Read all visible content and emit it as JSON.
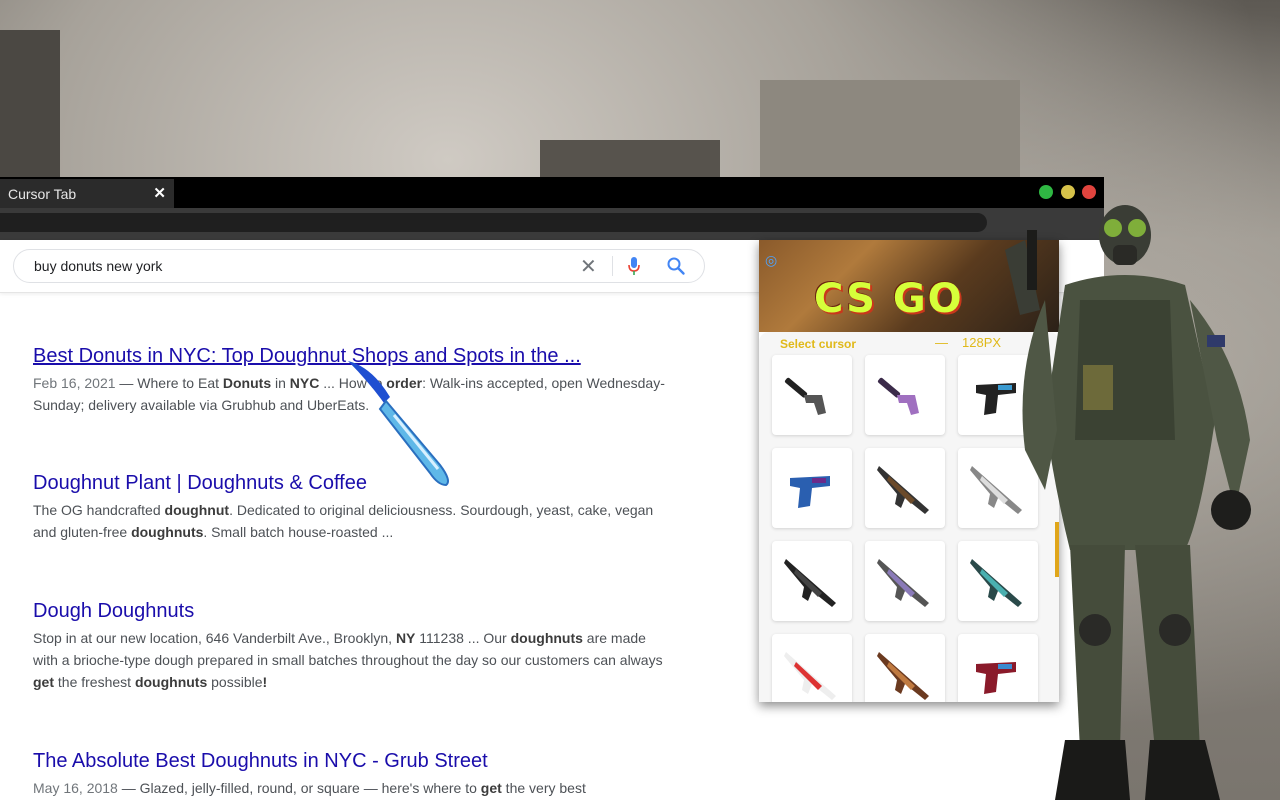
{
  "browser": {
    "tab_title": "Cursor Tab",
    "tab_close": "✕"
  },
  "search": {
    "query": "buy donuts new york",
    "clear_icon": "close-icon",
    "mic_icon": "mic-icon",
    "search_icon": "search-icon"
  },
  "results": [
    {
      "title": "Best Donuts in NYC: Top Doughnut Shops and Spots in the ...",
      "date": "Feb 16, 2021",
      "snippet_a": " — Where to Eat ",
      "b1": "Donuts",
      "snippet_b": " in ",
      "b2": "NYC",
      "snippet_c": " ... How to ",
      "b3": "order",
      "snippet_d": ": Walk-ins accepted, open Wednesday-Sunday; delivery available via Grubhub and UberEats."
    },
    {
      "title": "Doughnut Plant | Doughnuts & Coffee",
      "snippet_a": "The OG handcrafted ",
      "b1": "doughnut",
      "snippet_b": ". Dedicated to original deliciousness. Sourdough, yeast, cake, vegan and gluten-free ",
      "b2": "doughnuts",
      "snippet_c": ". Small batch house-roasted ..."
    },
    {
      "title": "Dough Doughnuts",
      "snippet_a": "Stop in at our new location, 646 Vanderbilt Ave., Brooklyn, ",
      "b1": "NY",
      "snippet_b": " 111238 ... Our ",
      "b2": "doughnuts",
      "snippet_c": " are made with a brioche-type dough prepared in small batches throughout the day so our customers can always ",
      "b3": "get",
      "snippet_d": " the freshest ",
      "b4": "doughnuts",
      "snippet_e": " possible",
      "b5": "!"
    },
    {
      "title": "The Absolute Best Doughnuts in NYC - Grub Street",
      "date": "May 16, 2018",
      "snippet_a": " — Glazed, jelly-filled, round, or square — here's where to ",
      "b1": "get",
      "snippet_b": " the very best"
    }
  ],
  "popup": {
    "banner_text": "CS GO",
    "close_label": "✕",
    "select_label": "Select cursor",
    "size_dash": "—",
    "size_value": "128PX",
    "cursors": [
      {
        "name": "usp-silencer-black"
      },
      {
        "name": "usp-silencer-purple"
      },
      {
        "name": "glock-blue"
      },
      {
        "name": "glock-teal"
      },
      {
        "name": "ak47-black"
      },
      {
        "name": "ak47-white"
      },
      {
        "name": "m4a4-black"
      },
      {
        "name": "m4a4-purple"
      },
      {
        "name": "ssg08-teal"
      },
      {
        "name": "awp-asiimov"
      },
      {
        "name": "ak47-wood"
      },
      {
        "name": "glock-red"
      }
    ]
  },
  "colors": {
    "dot_green": "#2fb843",
    "dot_yellow": "#d6c24a",
    "dot_red": "#e0443e",
    "link": "#1a0dab",
    "accent_gold": "#e0b91a"
  }
}
